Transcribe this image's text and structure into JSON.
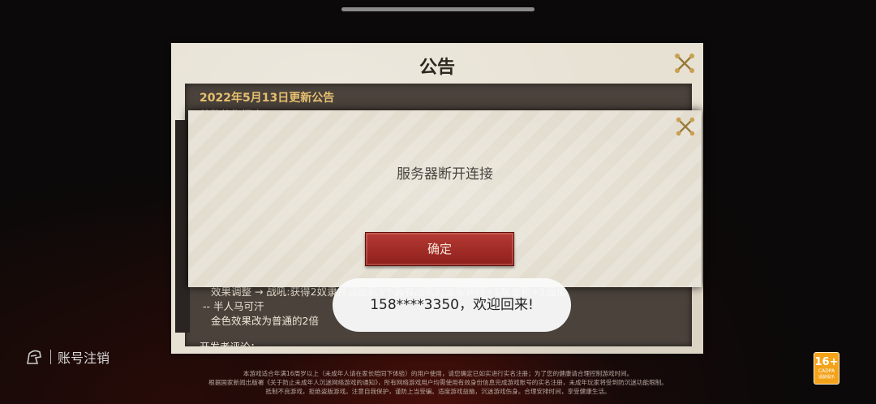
{
  "notice": {
    "title": "公告",
    "heading": "2022年5月13日更新公告",
    "subheading": "尊敬的指挥官：",
    "lines": [
      "效果调整 → 战吼:获得2奴隶并且随机3个具有战吼的友军获得+1攻击和+1强化",
      "-- 半人马可汗",
      "金色效果改为普通的2倍",
      "开发者评论："
    ]
  },
  "dialog": {
    "message": "服务器断开连接",
    "confirm_label": "确定"
  },
  "toast": {
    "message": "158****3350，欢迎回来!"
  },
  "account": {
    "label": "账号注销"
  },
  "footer": {
    "line1": "本游戏适合年满16周岁以上（未成年人请在家长陪同下体验）的用户使用，请您确定已如实进行实名注册；为了您的健康请合理控制游戏时间。",
    "line2": "根据国家新闻出版署《关于防止未成年人沉迷网络游戏的通知》，所有网络游戏用户均需使用有效身份信息完成游戏账号的实名注册，未成年玩家将受到防沉迷功能限制。",
    "line3": "抵制不良游戏，拒绝盗版游戏。注意自我保护，谨防上当受骗。适度游戏益脑，沉迷游戏伤身。合理安排时间，享受健康生活。"
  },
  "age_rating": {
    "number": "16+",
    "label": "CADPA",
    "sublabel": "适龄提示"
  },
  "colors": {
    "confirm_button": "#a52a26",
    "heading_gold": "#e8c070",
    "age_badge": "#f4a21a"
  }
}
